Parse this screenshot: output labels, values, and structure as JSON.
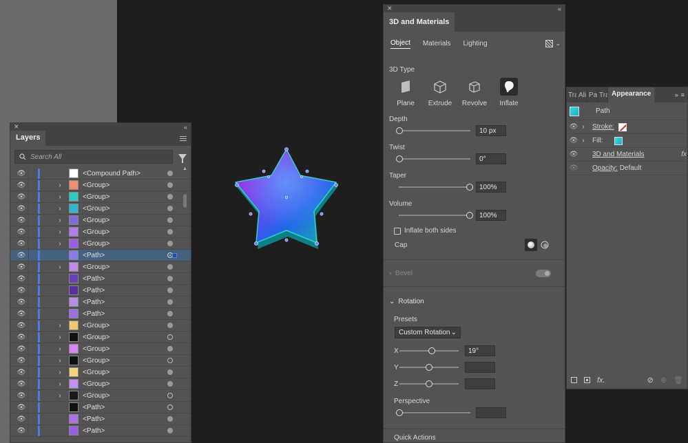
{
  "layers_panel": {
    "title": "Layers",
    "search_placeholder": "Search All",
    "rows": [
      {
        "name": "<Compound Path>",
        "expand": false,
        "thumb": "#ffffff",
        "target": "filled"
      },
      {
        "name": "<Group>",
        "expand": true,
        "thumb": "#f28c6a",
        "target": "filled"
      },
      {
        "name": "<Group>",
        "expand": true,
        "thumb": "#2ec9c0",
        "target": "filled"
      },
      {
        "name": "<Group>",
        "expand": true,
        "thumb": "#2fb8d4",
        "target": "filled"
      },
      {
        "name": "<Group>",
        "expand": true,
        "thumb": "#7d6be0",
        "target": "filled"
      },
      {
        "name": "<Group>",
        "expand": true,
        "thumb": "#b47ce8",
        "target": "filled"
      },
      {
        "name": "<Group>",
        "expand": true,
        "thumb": "#9b5de5",
        "target": "filled"
      },
      {
        "name": "<Path>",
        "expand": false,
        "thumb": "#8a7be6",
        "target": "selected",
        "selected": true
      },
      {
        "name": "<Group>",
        "expand": true,
        "thumb": "#c08ae8",
        "target": "filled"
      },
      {
        "name": "<Path>",
        "expand": false,
        "thumb": "#6b3fb8",
        "target": "filled"
      },
      {
        "name": "<Path>",
        "expand": false,
        "thumb": "#5a2fa0",
        "target": "filled"
      },
      {
        "name": "<Path>",
        "expand": false,
        "thumb": "#b78be8",
        "target": "filled"
      },
      {
        "name": "<Path>",
        "expand": false,
        "thumb": "#9a6fe0",
        "target": "filled"
      },
      {
        "name": "<Group>",
        "expand": true,
        "thumb": "#f2c96a",
        "target": "filled"
      },
      {
        "name": "<Group>",
        "expand": true,
        "thumb": "#111111",
        "target": "hollow"
      },
      {
        "name": "<Group>",
        "expand": true,
        "thumb": "#d884f0",
        "target": "filled"
      },
      {
        "name": "<Group>",
        "expand": true,
        "thumb": "#111111",
        "target": "hollow"
      },
      {
        "name": "<Group>",
        "expand": true,
        "thumb": "#f4d67a",
        "target": "filled"
      },
      {
        "name": "<Group>",
        "expand": true,
        "thumb": "#c38ff0",
        "target": "filled"
      },
      {
        "name": "<Group>",
        "expand": true,
        "thumb": "#1a1a1a",
        "target": "hollow"
      },
      {
        "name": "<Path>",
        "expand": false,
        "thumb": "#111111",
        "target": "hollow"
      },
      {
        "name": "<Path>",
        "expand": false,
        "thumb": "#b06ee8",
        "target": "filled"
      },
      {
        "name": "<Path>",
        "expand": false,
        "thumb": "#9b5de5",
        "target": "filled"
      }
    ]
  },
  "panel3d": {
    "title": "3D and Materials",
    "tabs": [
      "Object",
      "Materials",
      "Lighting"
    ],
    "active_tab": "Object",
    "type_label": "3D Type",
    "types": [
      {
        "label": "Plane",
        "icon": "plane-icon"
      },
      {
        "label": "Extrude",
        "icon": "extrude-icon"
      },
      {
        "label": "Revolve",
        "icon": "revolve-icon"
      },
      {
        "label": "Inflate",
        "icon": "inflate-icon",
        "active": true
      }
    ],
    "depth": {
      "label": "Depth",
      "value": "10 px",
      "level": 0
    },
    "twist": {
      "label": "Twist",
      "value": "0°",
      "level": 0
    },
    "taper": {
      "label": "Taper",
      "value": "100%",
      "level": 1
    },
    "volume": {
      "label": "Volume",
      "value": "100%",
      "level": 1
    },
    "inflate_both": "Inflate both sides",
    "cap_label": "Cap",
    "bevel_label": "Bevel",
    "rotation_label": "Rotation",
    "presets_label": "Presets",
    "preset_value": "Custom Rotation",
    "x": {
      "label": "X",
      "value": "19°",
      "level": 0.53
    },
    "y": {
      "label": "Y",
      "value": "",
      "level": 0.5
    },
    "z": {
      "label": "Z",
      "value": "",
      "level": 0.5
    },
    "perspective": {
      "label": "Perspective",
      "value": "",
      "level": 0
    },
    "quick_actions": "Quick Actions"
  },
  "appearance": {
    "mini_tabs": [
      "Tra",
      "Ali",
      "Pat",
      "Tra"
    ],
    "title": "Appearance",
    "object": "Path",
    "stroke_label": "Stroke:",
    "fill_label": "Fill:",
    "effect_label": "3D and Materials",
    "effect_fx": "fx",
    "opacity_label": "Opacity:",
    "opacity_value": "Default"
  }
}
